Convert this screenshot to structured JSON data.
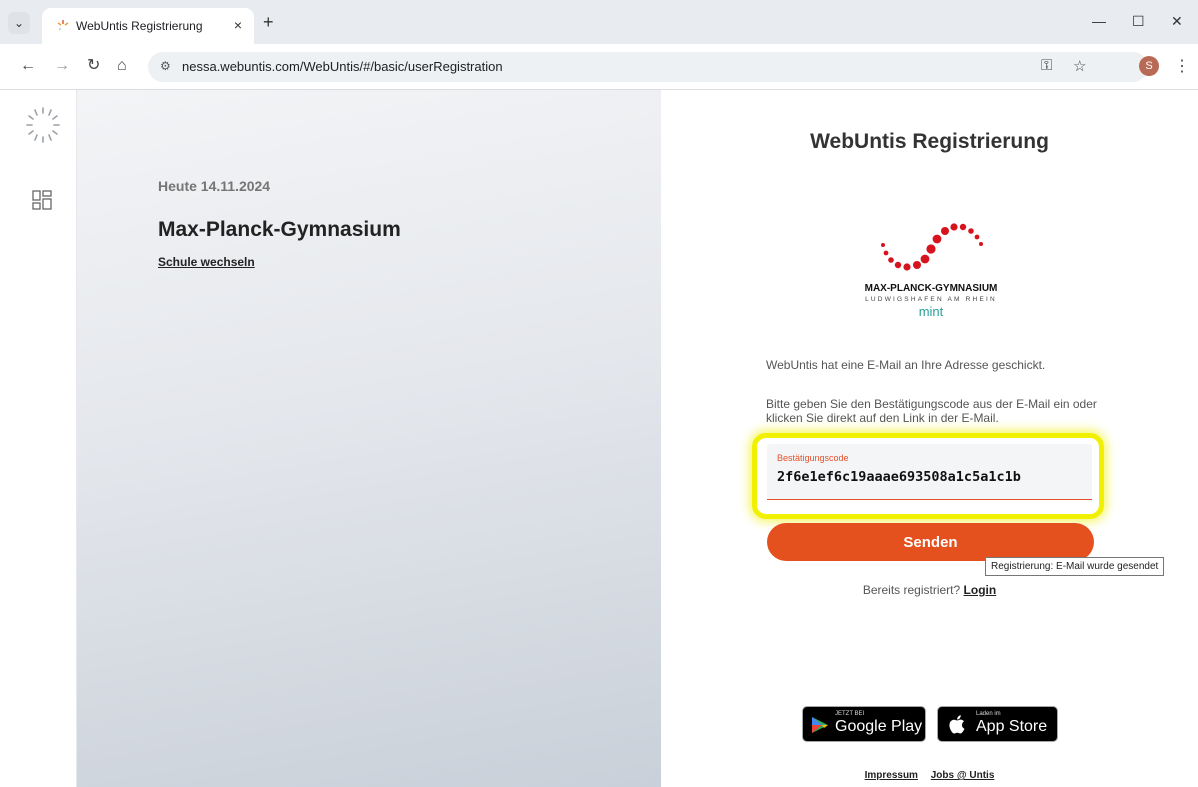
{
  "browser": {
    "tab_title": "WebUntis Registrierung",
    "tab_close": "×",
    "new_tab": "+",
    "url": "nessa.webuntis.com/WebUntis/#/basic/userRegistration",
    "profile_initial": "S",
    "icons": [
      "chevron-down-icon",
      "back-icon",
      "forward-icon",
      "reload-icon",
      "home-icon",
      "site-controls-icon",
      "key-icon",
      "star-icon",
      "more-icon",
      "minimize-icon",
      "maximize-icon",
      "close-window-icon"
    ]
  },
  "left": {
    "date": "Heute 14.11.2024",
    "school": "Max-Planck-Gymnasium",
    "switch_school": "Schule wechseln"
  },
  "right": {
    "heading": "WebUntis Registrierung",
    "logo": {
      "name": "MAX-PLANCK-GYMNASIUM",
      "city": "LUDWIGSHAFEN AM RHEIN",
      "mint": "mint"
    },
    "info_sent": "WebUntis hat eine E-Mail an Ihre Adresse geschickt.",
    "info_code": "Bitte geben Sie den Bestätigungscode aus der E-Mail ein oder klicken Sie direkt auf den Link in der E-Mail.",
    "code_label": "Bestätigungscode",
    "code_value": "2f6e1ef6c19aaae693508a1c5a1c1b",
    "send_label": "Senden",
    "tooltip": "Registrierung: E-Mail wurde gesendet",
    "registered_text": "Bereits registriert?",
    "login_label": "Login",
    "google_small": "JETZT BEI",
    "google_big": "Google Play",
    "apple_small": "Laden im",
    "apple_big": "App Store",
    "footer_impressum": "Impressum",
    "footer_jobs": "Jobs @ Untis"
  },
  "colors": {
    "accent": "#e4501e",
    "highlight": "#f0f000",
    "logo_red": "#d7141e",
    "mint": "#2aa198"
  }
}
